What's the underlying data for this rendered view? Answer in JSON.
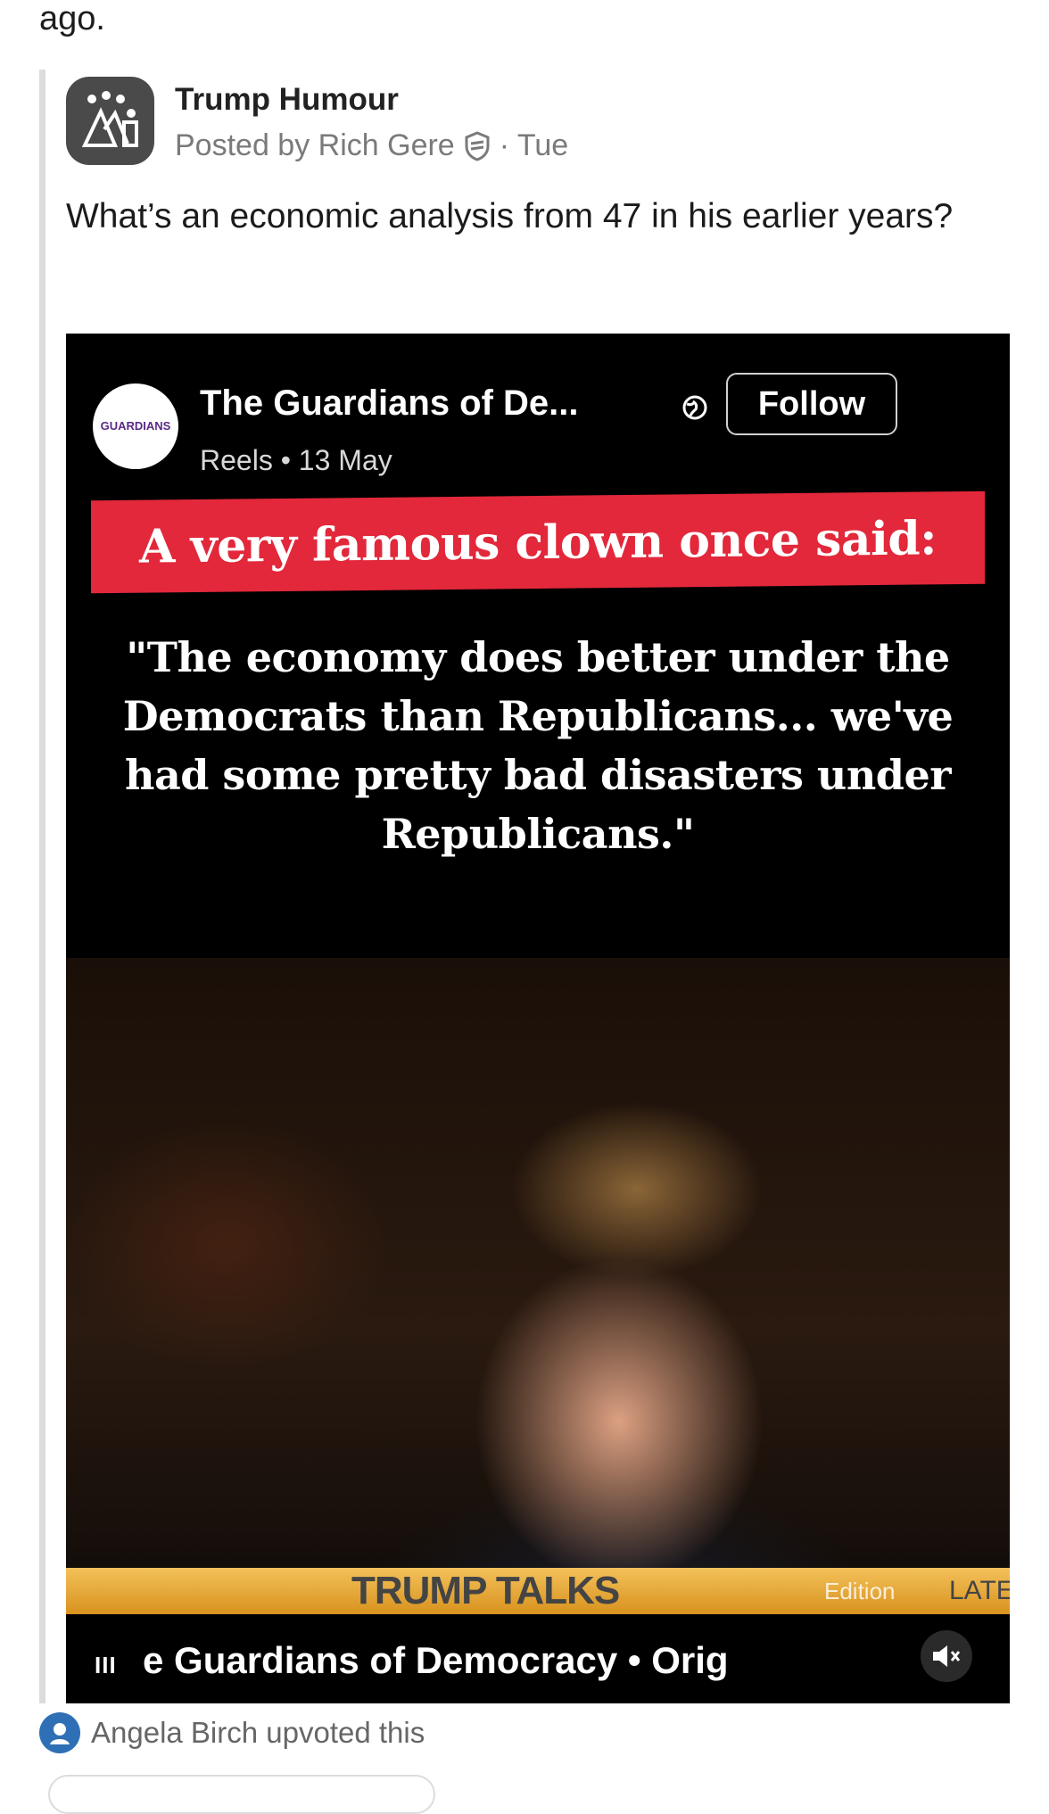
{
  "top_text": "ago.",
  "post": {
    "group_name": "Trump Humour",
    "posted_by": "Posted by Rich Gere",
    "time": "· Tue",
    "question": "What’s an economic analysis from 47 in his earlier years?"
  },
  "reel": {
    "page_name": "The Guardians of De...",
    "follow_label": "Follow",
    "sub": "Reels • 13 May",
    "logo_text": "GUARDIANS",
    "banner": "A very famous clown once said:",
    "quote": "\"The economy does better under the Democrats than Republicans... we've had some pretty bad disasters under Republicans.\"",
    "ticker_main": "TRUMP TALKS",
    "ticker_edition": "Edition",
    "ticker_late": "LATE",
    "bottom_text": "e Guardians of Democracy • Orig",
    "bars_icon": "III"
  },
  "activity": {
    "upvote_text": "Angela Birch upvoted this"
  },
  "colors": {
    "banner_red": "#e2283a",
    "avatar_bg": "#4a4a4a",
    "upvote_blue": "#2f6fb5"
  }
}
